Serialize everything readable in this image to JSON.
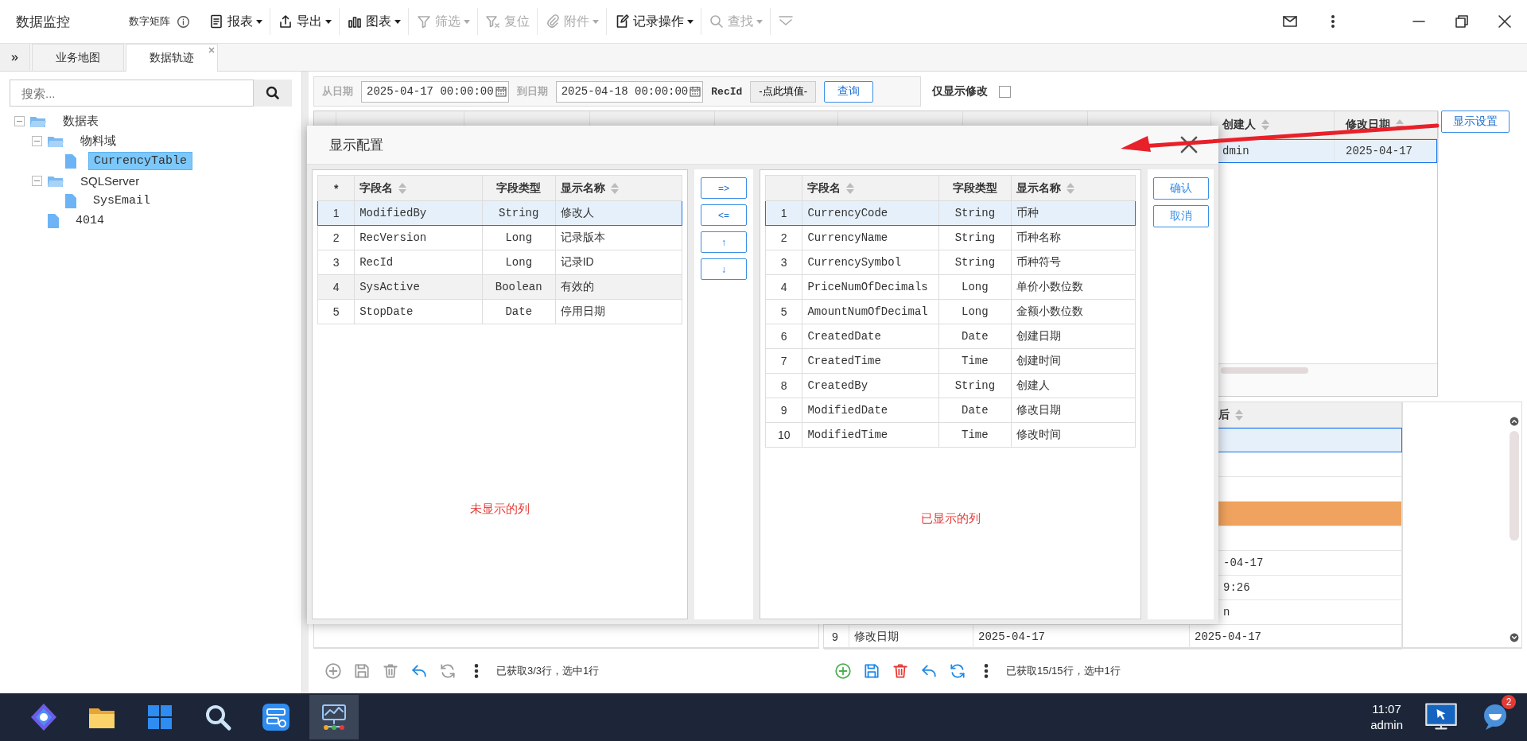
{
  "window": {
    "title": "数据监控",
    "subtitle": "数字矩阵"
  },
  "toolbar": [
    {
      "kind": "report",
      "label": "报表",
      "dropdown": true,
      "disabled": false
    },
    {
      "kind": "export",
      "label": "导出",
      "dropdown": true,
      "disabled": false
    },
    {
      "kind": "chart",
      "label": "图表",
      "dropdown": true,
      "disabled": false
    },
    {
      "kind": "filter",
      "label": "筛选",
      "dropdown": true,
      "disabled": true
    },
    {
      "kind": "reset",
      "label": "复位",
      "dropdown": false,
      "disabled": true
    },
    {
      "kind": "attachment",
      "label": "附件",
      "dropdown": true,
      "disabled": true
    },
    {
      "kind": "record",
      "label": "记录操作",
      "dropdown": true,
      "disabled": false
    },
    {
      "kind": "search",
      "label": "查找",
      "dropdown": true,
      "disabled": true
    },
    {
      "kind": "collapse",
      "dropdown": false,
      "disabled": true
    }
  ],
  "tab_scroll": "»",
  "tabs": [
    {
      "label": "业务地图",
      "selected": false,
      "closable": false
    },
    {
      "label": "数据轨迹",
      "selected": true,
      "closable": true
    }
  ],
  "sidebar": {
    "search": {
      "placeholder": "搜索..."
    },
    "tree": [
      {
        "label": "数据表",
        "kind": "folder",
        "expanded": true,
        "selected": false,
        "children": [
          {
            "label": "物料域",
            "kind": "folder",
            "expanded": true,
            "selected": false,
            "children": [
              {
                "label": "CurrencyTable",
                "kind": "file",
                "selected": true
              }
            ]
          },
          {
            "label": "SQLServer",
            "kind": "folder",
            "expanded": true,
            "selected": false,
            "children": [
              {
                "label": "SysEmail",
                "kind": "file",
                "selected": false
              }
            ]
          },
          {
            "label": "4014",
            "kind": "file",
            "selected": false
          }
        ]
      }
    ]
  },
  "filter": {
    "from_label": "从日期",
    "from_value": "2025-04-17 00:00:00",
    "to_label": "到日期",
    "to_value": "2025-04-18 00:00:00",
    "recid_label": "RecId",
    "recid_button": "-点此填值-",
    "query_button": "查询",
    "only_modified": {
      "label": "仅显示修改",
      "checked": false
    }
  },
  "upper_table": {
    "columns": [
      "创建人",
      "修改日期"
    ],
    "rows": [
      {
        "selected": true,
        "cells": [
          "dmin",
          "2025-04-17"
        ]
      }
    ],
    "settings_button": "显示设置"
  },
  "lower_right_table": {
    "header": "后",
    "rows": [
      {
        "selected": true,
        "marked": false
      },
      {
        "selected": false,
        "marked": false
      },
      {
        "selected": false,
        "marked": false
      },
      {
        "selected": false,
        "marked": true
      },
      {
        "selected": false,
        "marked": false
      },
      {
        "selected": false,
        "marked": false,
        "value": "-04-17"
      },
      {
        "selected": false,
        "marked": false,
        "value": "9:26"
      },
      {
        "selected": false,
        "marked": false,
        "value": "n"
      },
      {
        "selected": false,
        "marked": false,
        "number": "9",
        "field": "修改日期",
        "before": "2025-04-17",
        "value": "2025-04-17"
      }
    ]
  },
  "bottom_bars": [
    {
      "actions": [
        {
          "kind": "add",
          "disabled": true
        },
        {
          "kind": "save",
          "disabled": true
        },
        {
          "kind": "delete",
          "disabled": true
        },
        {
          "kind": "undo",
          "disabled": false
        },
        {
          "kind": "refresh",
          "disabled": true
        },
        {
          "kind": "more",
          "disabled": false
        }
      ],
      "status": "已获取3/3行，选中1行"
    },
    {
      "actions": [
        {
          "kind": "add",
          "disabled": false
        },
        {
          "kind": "save",
          "disabled": false
        },
        {
          "kind": "delete",
          "disabled": false
        },
        {
          "kind": "undo",
          "disabled": false
        },
        {
          "kind": "refresh",
          "disabled": false
        },
        {
          "kind": "more",
          "disabled": false
        }
      ],
      "status": "已获取15/15行，选中1行"
    }
  ],
  "dialog": {
    "title": "显示配置",
    "hidden_table": {
      "corner": "*",
      "columns": [
        {
          "label": "字段名",
          "sortable": true
        },
        {
          "label": "字段类型",
          "sortable": false
        },
        {
          "label": "显示名称",
          "sortable": true
        }
      ],
      "rows": [
        {
          "number": "1",
          "field": "ModifiedBy",
          "type": "String",
          "display": "修改人",
          "selected": true,
          "highlighted": false
        },
        {
          "number": "2",
          "field": "RecVersion",
          "type": "Long",
          "display": "记录版本",
          "selected": false,
          "highlighted": false
        },
        {
          "number": "3",
          "field": "RecId",
          "type": "Long",
          "display": "记录ID",
          "selected": false,
          "highlighted": false
        },
        {
          "number": "4",
          "field": "SysActive",
          "type": "Boolean",
          "display": "有效的",
          "selected": false,
          "highlighted": true
        },
        {
          "number": "5",
          "field": "StopDate",
          "type": "Date",
          "display": "停用日期",
          "selected": false,
          "highlighted": false
        }
      ],
      "note": "未显示的列"
    },
    "move_buttons": [
      "=>",
      "<=",
      "↑",
      "↓"
    ],
    "shown_table": {
      "columns": [
        {
          "label": "字段名",
          "sortable": true
        },
        {
          "label": "字段类型",
          "sortable": false
        },
        {
          "label": "显示名称",
          "sortable": true
        }
      ],
      "rows": [
        {
          "number": "1",
          "field": "CurrencyCode",
          "type": "String",
          "display": "币种",
          "selected": true,
          "highlighted": false
        },
        {
          "number": "2",
          "field": "CurrencyName",
          "type": "String",
          "display": "币种名称",
          "selected": false,
          "highlighted": false
        },
        {
          "number": "3",
          "field": "CurrencySymbol",
          "type": "String",
          "display": "币种符号",
          "selected": false,
          "highlighted": false
        },
        {
          "number": "4",
          "field": "PriceNumOfDecimals",
          "type": "Long",
          "display": "单价小数位数",
          "selected": false,
          "highlighted": false
        },
        {
          "number": "5",
          "field": "AmountNumOfDecimal",
          "type": "Long",
          "display": "金额小数位数",
          "selected": false,
          "highlighted": false
        },
        {
          "number": "6",
          "field": "CreatedDate",
          "type": "Date",
          "display": "创建日期",
          "selected": false,
          "highlighted": false
        },
        {
          "number": "7",
          "field": "CreatedTime",
          "type": "Time",
          "display": "创建时间",
          "selected": false,
          "highlighted": false
        },
        {
          "number": "8",
          "field": "CreatedBy",
          "type": "String",
          "display": "创建人",
          "selected": false,
          "highlighted": false
        },
        {
          "number": "9",
          "field": "ModifiedDate",
          "type": "Date",
          "display": "修改日期",
          "selected": false,
          "highlighted": false
        },
        {
          "number": "10",
          "field": "ModifiedTime",
          "type": "Time",
          "display": "修改时间",
          "selected": false,
          "highlighted": false
        }
      ],
      "note": "已显示的列"
    },
    "actions": [
      "确认",
      "取消"
    ]
  },
  "taskbar": {
    "apps": [
      {
        "kind": "logo",
        "selected": false
      },
      {
        "kind": "folder",
        "selected": false
      },
      {
        "kind": "tiles",
        "selected": false
      },
      {
        "kind": "search",
        "selected": false
      },
      {
        "kind": "server",
        "selected": false
      },
      {
        "kind": "network",
        "selected": true
      }
    ],
    "time": "11:07",
    "user": "admin",
    "badge": "2"
  }
}
